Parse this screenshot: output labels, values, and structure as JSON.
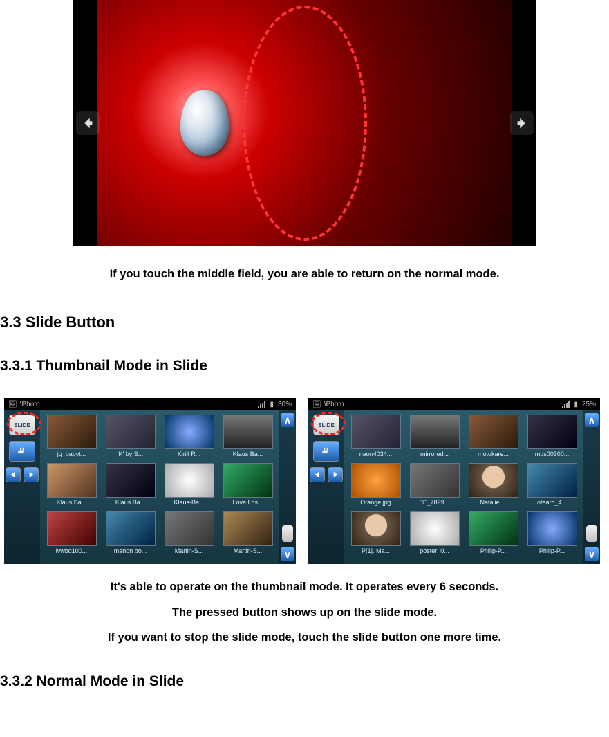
{
  "viewer": {
    "caption": "If you touch the middle field, you are able to return on the normal mode."
  },
  "headings": {
    "h2_slide_button": "3.3 Slide Button",
    "h3_thumbnail_mode": "3.3.1 Thumbnail Mode in Slide",
    "h3_normal_mode": "3.3.2 Normal Mode in Slide"
  },
  "thumb_captions": {
    "line1": "It's able to operate on the thumbnail mode. It operates every 6 seconds.",
    "line2": "The pressed button shows up on the slide mode.",
    "line3": "If you want to stop the slide mode, touch the slide button one more time."
  },
  "panel_common": {
    "app_title": "\\Photo",
    "slide_button_label": "SLIDE"
  },
  "panel_left": {
    "battery": "30%",
    "items": [
      {
        "label": "jg_babyt...",
        "bg": "bg-a"
      },
      {
        "label": "'K' by S...",
        "bg": "bg-b"
      },
      {
        "label": "Kirill R...",
        "bg": "bg-c"
      },
      {
        "label": "Klaus Ba...",
        "bg": "bg-d"
      },
      {
        "label": "Klaus Ba...",
        "bg": "bg-e"
      },
      {
        "label": "Klaus Ba...",
        "bg": "bg-f"
      },
      {
        "label": "Klaus-Ba...",
        "bg": "bg-g"
      },
      {
        "label": "Love Los...",
        "bg": "bg-h"
      },
      {
        "label": "lvwbd100...",
        "bg": "bg-i"
      },
      {
        "label": "manon bo...",
        "bg": "bg-j"
      },
      {
        "label": "Martin-S...",
        "bg": "bg-k"
      },
      {
        "label": "Martin-S...",
        "bg": "bg-l"
      }
    ]
  },
  "panel_right": {
    "battery": "25%",
    "items": [
      {
        "label": "naon4034...",
        "bg": "bg-b"
      },
      {
        "label": "mirrored...",
        "bg": "bg-d"
      },
      {
        "label": "motokare...",
        "bg": "bg-a"
      },
      {
        "label": "mus00300...",
        "bg": "bg-f"
      },
      {
        "label": "Orange.jpg",
        "bg": "bg-orange"
      },
      {
        "label": "□□_7899...",
        "bg": "bg-k"
      },
      {
        "label": "Natalie ...",
        "bg": "bg-face"
      },
      {
        "label": "otearo_4...",
        "bg": "bg-j"
      },
      {
        "label": "P[1]. Ma...",
        "bg": "bg-face"
      },
      {
        "label": "poster_0...",
        "bg": "bg-g"
      },
      {
        "label": "Philip-P...",
        "bg": "bg-h"
      },
      {
        "label": "Philip-P...",
        "bg": "bg-c"
      }
    ]
  }
}
